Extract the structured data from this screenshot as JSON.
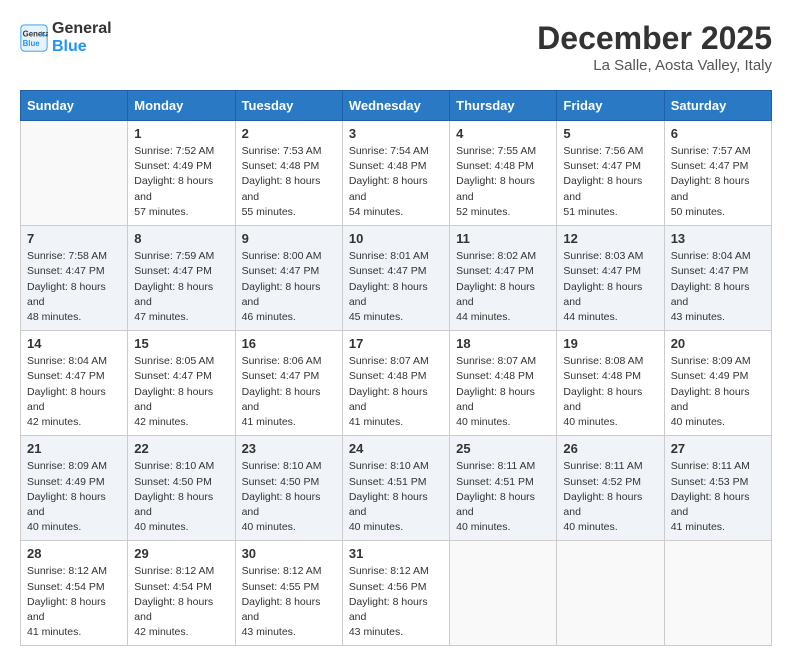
{
  "header": {
    "logo_line1": "General",
    "logo_line2": "Blue",
    "month": "December 2025",
    "location": "La Salle, Aosta Valley, Italy"
  },
  "weekdays": [
    "Sunday",
    "Monday",
    "Tuesday",
    "Wednesday",
    "Thursday",
    "Friday",
    "Saturday"
  ],
  "weeks": [
    [
      {
        "day": "",
        "sunrise": "",
        "sunset": "",
        "daylight": ""
      },
      {
        "day": "1",
        "sunrise": "Sunrise: 7:52 AM",
        "sunset": "Sunset: 4:49 PM",
        "daylight": "Daylight: 8 hours and 57 minutes."
      },
      {
        "day": "2",
        "sunrise": "Sunrise: 7:53 AM",
        "sunset": "Sunset: 4:48 PM",
        "daylight": "Daylight: 8 hours and 55 minutes."
      },
      {
        "day": "3",
        "sunrise": "Sunrise: 7:54 AM",
        "sunset": "Sunset: 4:48 PM",
        "daylight": "Daylight: 8 hours and 54 minutes."
      },
      {
        "day": "4",
        "sunrise": "Sunrise: 7:55 AM",
        "sunset": "Sunset: 4:48 PM",
        "daylight": "Daylight: 8 hours and 52 minutes."
      },
      {
        "day": "5",
        "sunrise": "Sunrise: 7:56 AM",
        "sunset": "Sunset: 4:47 PM",
        "daylight": "Daylight: 8 hours and 51 minutes."
      },
      {
        "day": "6",
        "sunrise": "Sunrise: 7:57 AM",
        "sunset": "Sunset: 4:47 PM",
        "daylight": "Daylight: 8 hours and 50 minutes."
      }
    ],
    [
      {
        "day": "7",
        "sunrise": "Sunrise: 7:58 AM",
        "sunset": "Sunset: 4:47 PM",
        "daylight": "Daylight: 8 hours and 48 minutes."
      },
      {
        "day": "8",
        "sunrise": "Sunrise: 7:59 AM",
        "sunset": "Sunset: 4:47 PM",
        "daylight": "Daylight: 8 hours and 47 minutes."
      },
      {
        "day": "9",
        "sunrise": "Sunrise: 8:00 AM",
        "sunset": "Sunset: 4:47 PM",
        "daylight": "Daylight: 8 hours and 46 minutes."
      },
      {
        "day": "10",
        "sunrise": "Sunrise: 8:01 AM",
        "sunset": "Sunset: 4:47 PM",
        "daylight": "Daylight: 8 hours and 45 minutes."
      },
      {
        "day": "11",
        "sunrise": "Sunrise: 8:02 AM",
        "sunset": "Sunset: 4:47 PM",
        "daylight": "Daylight: 8 hours and 44 minutes."
      },
      {
        "day": "12",
        "sunrise": "Sunrise: 8:03 AM",
        "sunset": "Sunset: 4:47 PM",
        "daylight": "Daylight: 8 hours and 44 minutes."
      },
      {
        "day": "13",
        "sunrise": "Sunrise: 8:04 AM",
        "sunset": "Sunset: 4:47 PM",
        "daylight": "Daylight: 8 hours and 43 minutes."
      }
    ],
    [
      {
        "day": "14",
        "sunrise": "Sunrise: 8:04 AM",
        "sunset": "Sunset: 4:47 PM",
        "daylight": "Daylight: 8 hours and 42 minutes."
      },
      {
        "day": "15",
        "sunrise": "Sunrise: 8:05 AM",
        "sunset": "Sunset: 4:47 PM",
        "daylight": "Daylight: 8 hours and 42 minutes."
      },
      {
        "day": "16",
        "sunrise": "Sunrise: 8:06 AM",
        "sunset": "Sunset: 4:47 PM",
        "daylight": "Daylight: 8 hours and 41 minutes."
      },
      {
        "day": "17",
        "sunrise": "Sunrise: 8:07 AM",
        "sunset": "Sunset: 4:48 PM",
        "daylight": "Daylight: 8 hours and 41 minutes."
      },
      {
        "day": "18",
        "sunrise": "Sunrise: 8:07 AM",
        "sunset": "Sunset: 4:48 PM",
        "daylight": "Daylight: 8 hours and 40 minutes."
      },
      {
        "day": "19",
        "sunrise": "Sunrise: 8:08 AM",
        "sunset": "Sunset: 4:48 PM",
        "daylight": "Daylight: 8 hours and 40 minutes."
      },
      {
        "day": "20",
        "sunrise": "Sunrise: 8:09 AM",
        "sunset": "Sunset: 4:49 PM",
        "daylight": "Daylight: 8 hours and 40 minutes."
      }
    ],
    [
      {
        "day": "21",
        "sunrise": "Sunrise: 8:09 AM",
        "sunset": "Sunset: 4:49 PM",
        "daylight": "Daylight: 8 hours and 40 minutes."
      },
      {
        "day": "22",
        "sunrise": "Sunrise: 8:10 AM",
        "sunset": "Sunset: 4:50 PM",
        "daylight": "Daylight: 8 hours and 40 minutes."
      },
      {
        "day": "23",
        "sunrise": "Sunrise: 8:10 AM",
        "sunset": "Sunset: 4:50 PM",
        "daylight": "Daylight: 8 hours and 40 minutes."
      },
      {
        "day": "24",
        "sunrise": "Sunrise: 8:10 AM",
        "sunset": "Sunset: 4:51 PM",
        "daylight": "Daylight: 8 hours and 40 minutes."
      },
      {
        "day": "25",
        "sunrise": "Sunrise: 8:11 AM",
        "sunset": "Sunset: 4:51 PM",
        "daylight": "Daylight: 8 hours and 40 minutes."
      },
      {
        "day": "26",
        "sunrise": "Sunrise: 8:11 AM",
        "sunset": "Sunset: 4:52 PM",
        "daylight": "Daylight: 8 hours and 40 minutes."
      },
      {
        "day": "27",
        "sunrise": "Sunrise: 8:11 AM",
        "sunset": "Sunset: 4:53 PM",
        "daylight": "Daylight: 8 hours and 41 minutes."
      }
    ],
    [
      {
        "day": "28",
        "sunrise": "Sunrise: 8:12 AM",
        "sunset": "Sunset: 4:54 PM",
        "daylight": "Daylight: 8 hours and 41 minutes."
      },
      {
        "day": "29",
        "sunrise": "Sunrise: 8:12 AM",
        "sunset": "Sunset: 4:54 PM",
        "daylight": "Daylight: 8 hours and 42 minutes."
      },
      {
        "day": "30",
        "sunrise": "Sunrise: 8:12 AM",
        "sunset": "Sunset: 4:55 PM",
        "daylight": "Daylight: 8 hours and 43 minutes."
      },
      {
        "day": "31",
        "sunrise": "Sunrise: 8:12 AM",
        "sunset": "Sunset: 4:56 PM",
        "daylight": "Daylight: 8 hours and 43 minutes."
      },
      {
        "day": "",
        "sunrise": "",
        "sunset": "",
        "daylight": ""
      },
      {
        "day": "",
        "sunrise": "",
        "sunset": "",
        "daylight": ""
      },
      {
        "day": "",
        "sunrise": "",
        "sunset": "",
        "daylight": ""
      }
    ]
  ]
}
